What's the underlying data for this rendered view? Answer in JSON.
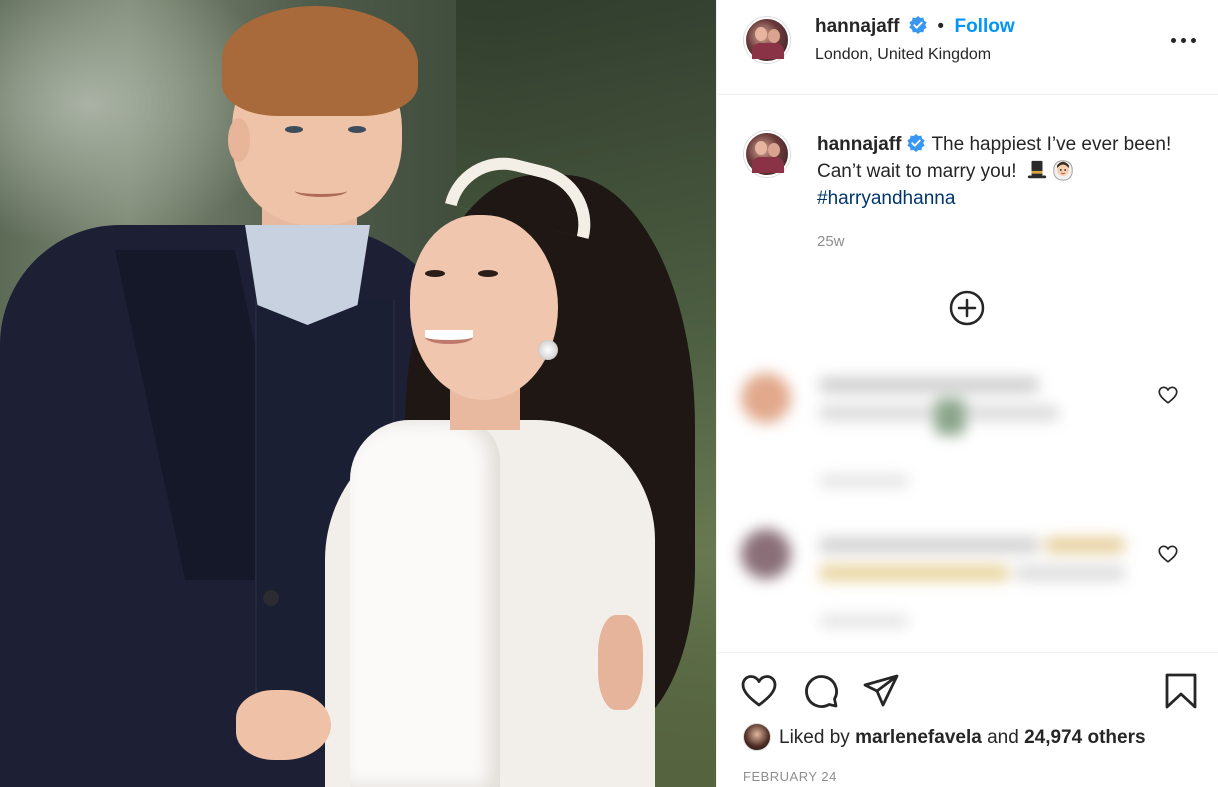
{
  "post": {
    "username": "hannajaff",
    "follow_label": "Follow",
    "separator": "•",
    "location": "London, United Kingdom",
    "caption_text": "The happiest I’ve ever been! Can’t wait to marry you!",
    "caption_emojis": [
      "top-hat-icon",
      "bride-with-veil-icon"
    ],
    "hashtag": "#harryandhanna",
    "age": "25w",
    "liked_by_prefix": "Liked by",
    "liked_by_user": "marlenefavela",
    "liked_by_and": "and",
    "liked_by_count": "24,974 others",
    "date": "FEBRUARY 24"
  },
  "colors": {
    "follow_blue": "#0095f6",
    "verified_blue": "#3897f0",
    "hashtag_link": "#00376b",
    "muted_text": "#8e8e8e"
  },
  "actions": [
    "heart-icon",
    "comment-icon",
    "share-icon",
    "bookmark-icon"
  ]
}
